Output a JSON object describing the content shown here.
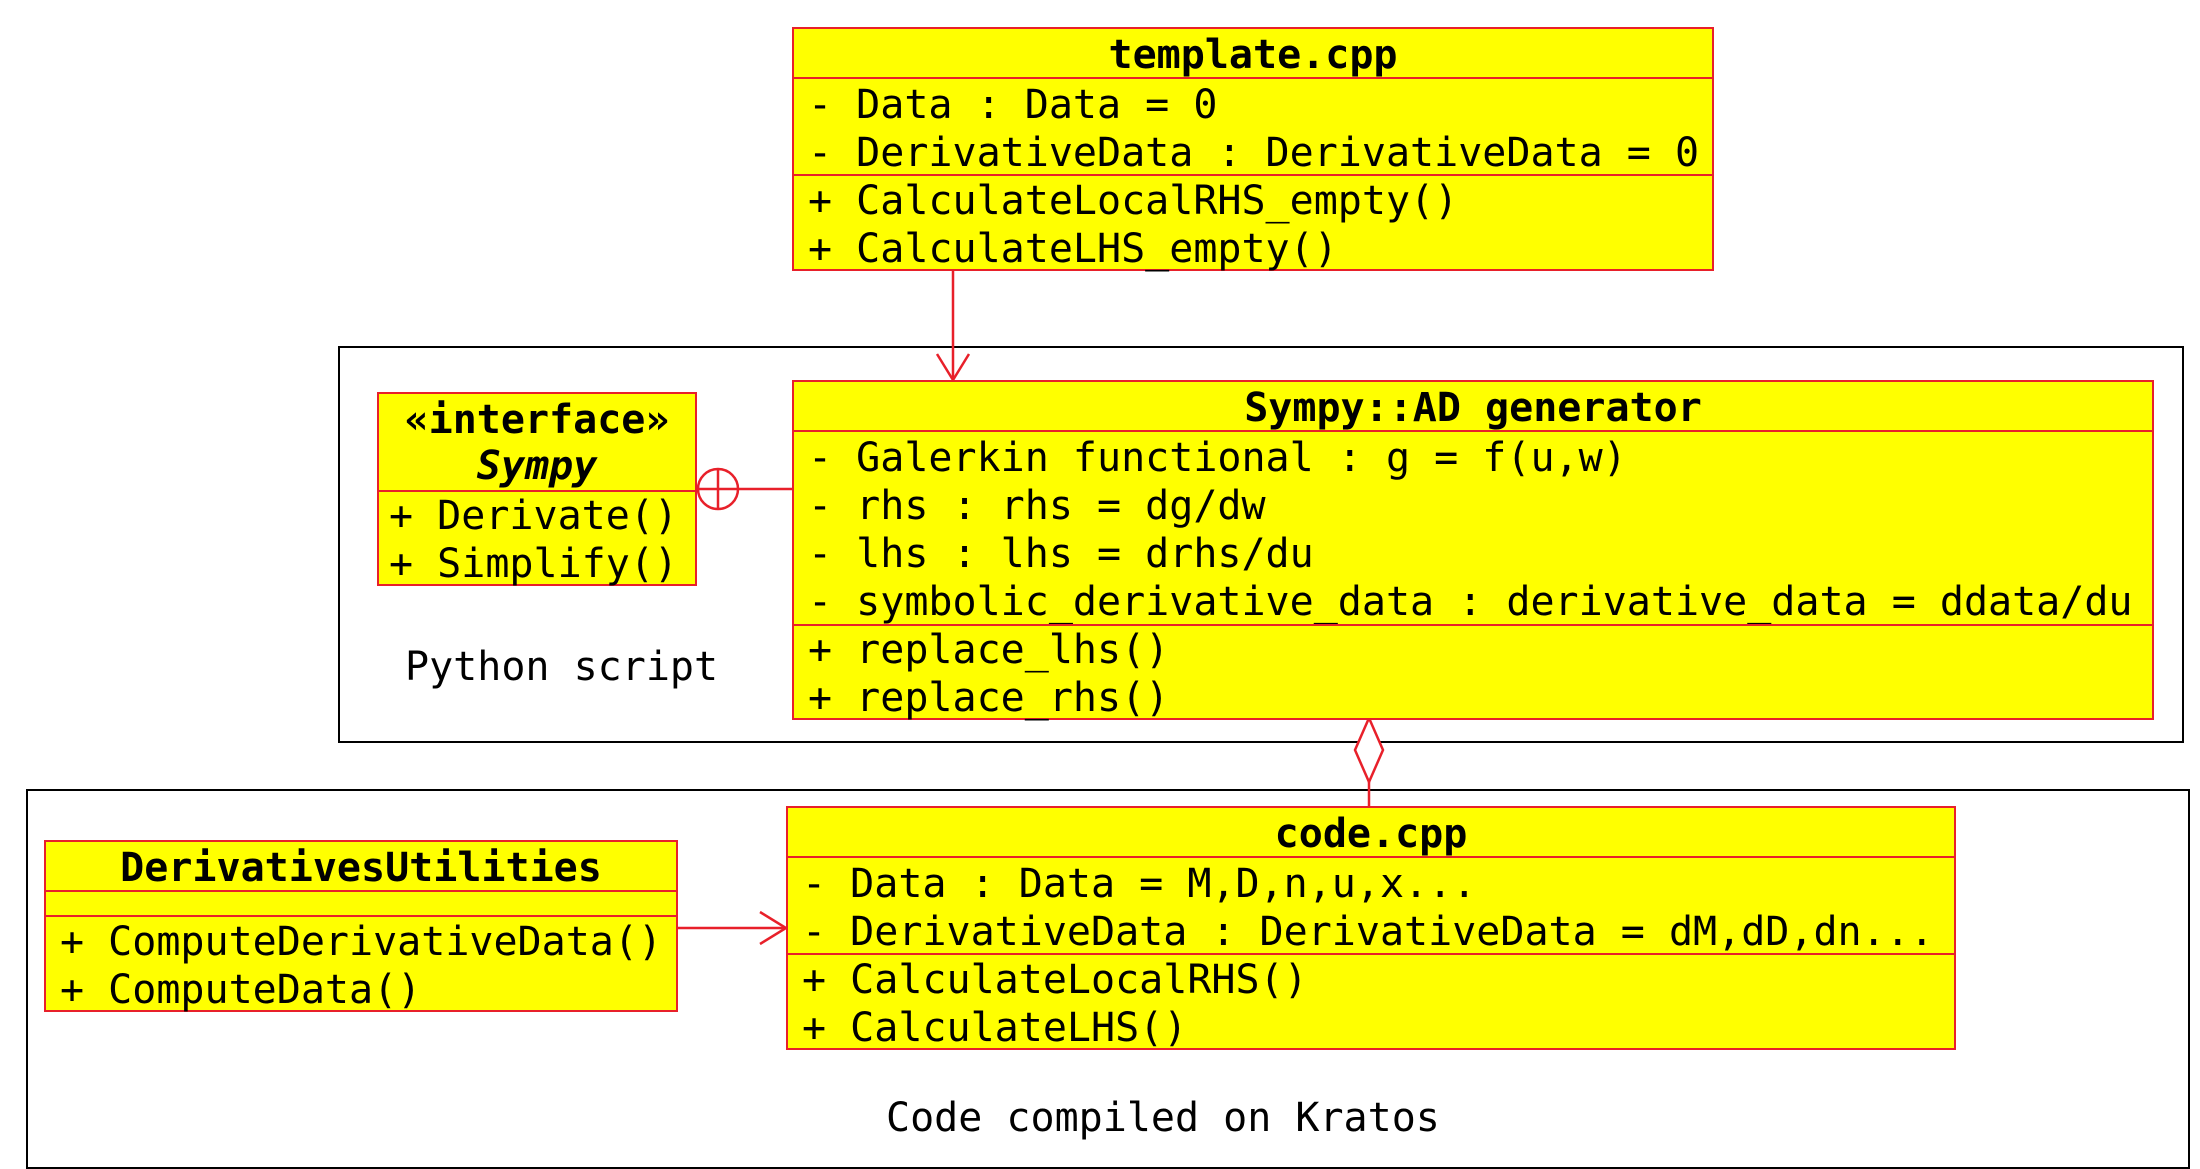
{
  "colors": {
    "class_fill": "#ffff00",
    "class_border": "#e8202a",
    "connector": "#e8202a",
    "package_border": "#000000"
  },
  "packages": {
    "python": {
      "label": "Python script"
    },
    "kratos": {
      "label": "Code compiled on Kratos"
    }
  },
  "classes": {
    "template": {
      "name": "template.cpp",
      "attributes": [
        "- Data : Data = 0",
        "- DerivativeData : DerivativeData = 0"
      ],
      "methods": [
        "+ CalculateLocalRHS_empty()",
        "+ CalculateLHS_empty()"
      ]
    },
    "sympy": {
      "stereotype": "«interface»",
      "name": "Sympy",
      "methods": [
        "+ Derivate()",
        "+ Simplify()"
      ]
    },
    "generator": {
      "name": "Sympy::AD generator",
      "attributes": [
        "- Galerkin functional : g = f(u,w)",
        "- rhs : rhs = dg/dw",
        "- lhs : lhs = drhs/du",
        "- symbolic_derivative_data : derivative_data = ddata/du"
      ],
      "methods": [
        "+ replace_lhs()",
        "+ replace_rhs()"
      ]
    },
    "utilities": {
      "name": "DerivativesUtilities",
      "attributes": [],
      "methods": [
        "+ ComputeDerivativeData()",
        "+ ComputeData()"
      ]
    },
    "code": {
      "name": "code.cpp",
      "attributes": [
        "- Data : Data = M,D,n,u,x...",
        "- DerivativeData : DerivativeData = dM,dD,dn..."
      ],
      "methods": [
        "+ CalculateLocalRHS()",
        "+ CalculateLHS()"
      ]
    }
  }
}
